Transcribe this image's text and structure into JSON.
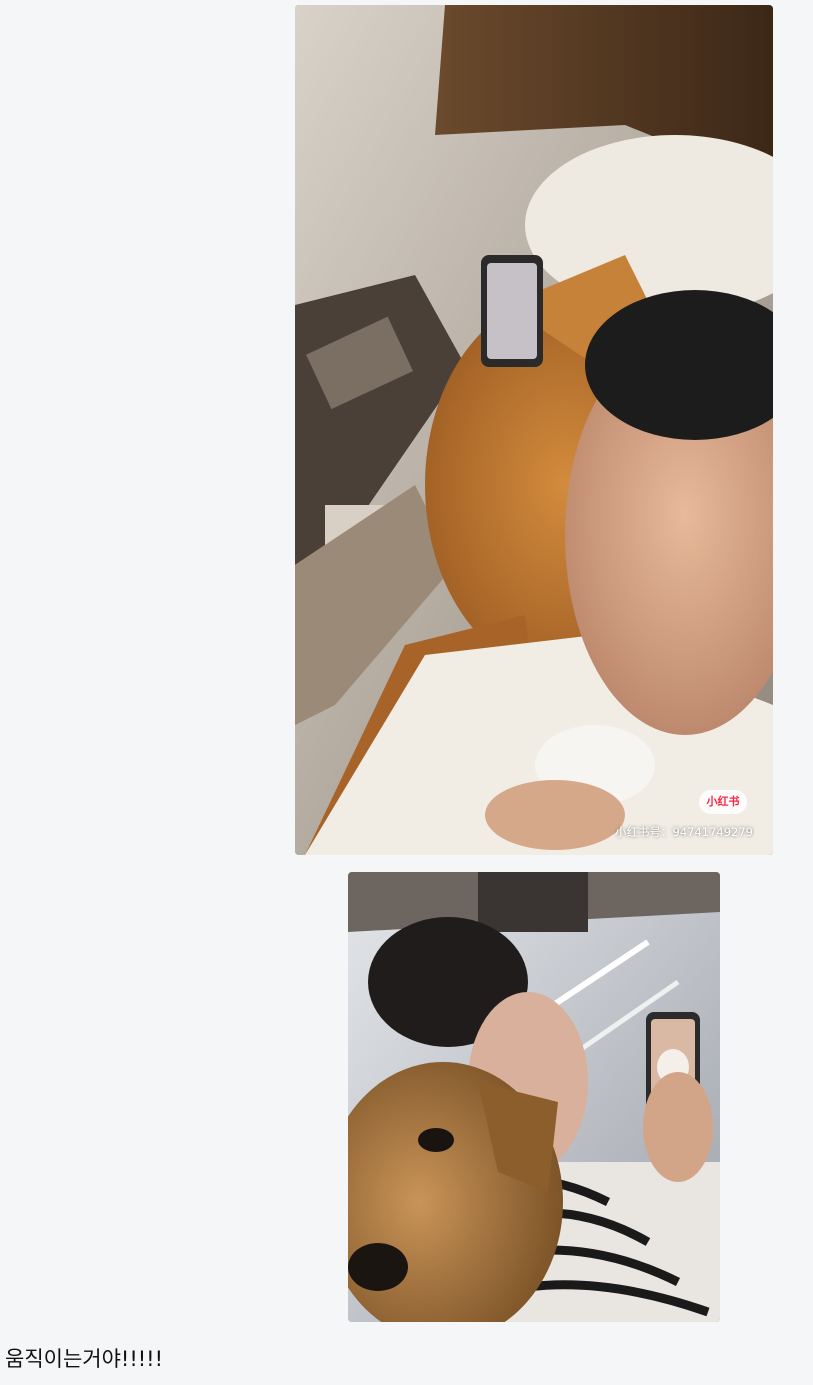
{
  "post": {
    "images": [
      {
        "description_icon": "photo-man-crying-with-golden-retriever-icon",
        "watermark_badge": "小红书",
        "watermark_id": "小红书号：94741749279"
      },
      {
        "description_icon": "photo-dog-crying-with-owner-icon"
      }
    ],
    "caption": "움직이는거야!!!!!"
  }
}
